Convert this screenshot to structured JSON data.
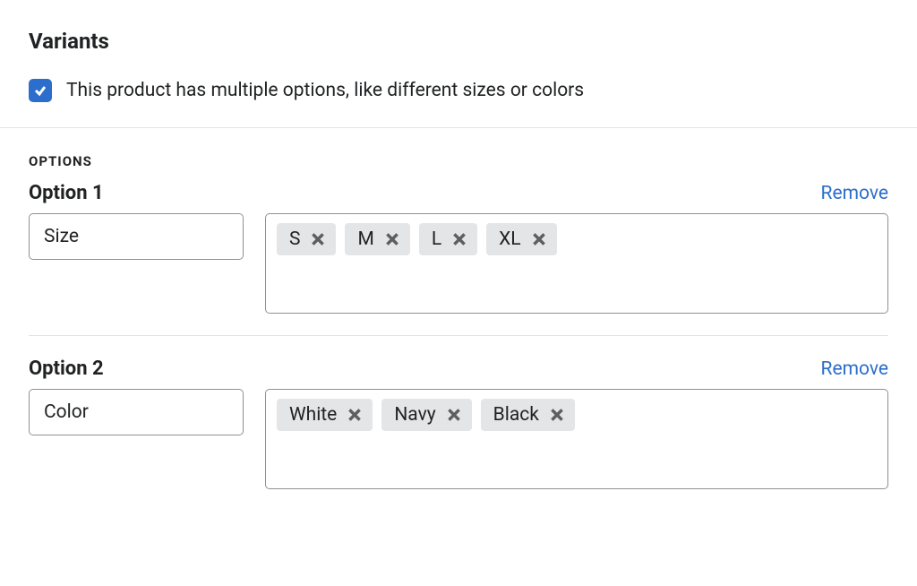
{
  "section_title": "Variants",
  "checkbox_label": "This product has multiple options, like different sizes or colors",
  "options_heading": "OPTIONS",
  "remove_label": "Remove",
  "options": [
    {
      "title": "Option 1",
      "name": "Size",
      "values": [
        "S",
        "M",
        "L",
        "XL"
      ]
    },
    {
      "title": "Option 2",
      "name": "Color",
      "values": [
        "White",
        "Navy",
        "Black"
      ]
    }
  ]
}
